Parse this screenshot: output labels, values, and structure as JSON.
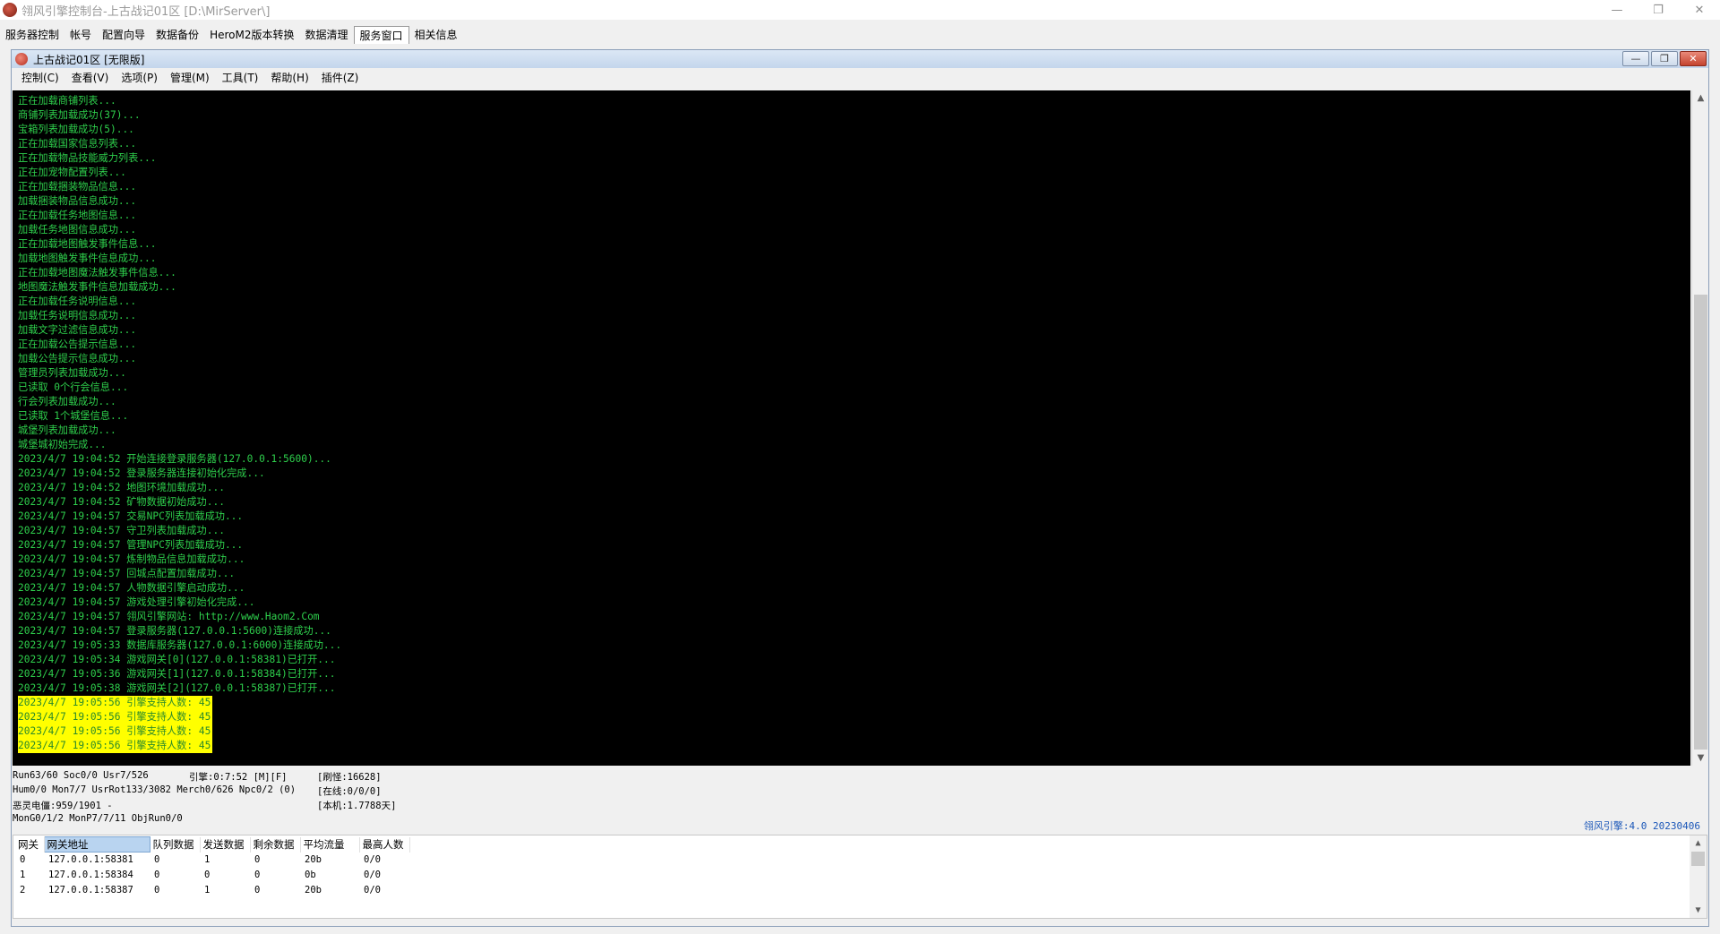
{
  "window": {
    "title": "翎风引擎控制台-上古战记01区 [D:\\MirServer\\]",
    "minimize": "—",
    "maximize": "❐",
    "close": "✕"
  },
  "outer_menu": [
    "服务器控制",
    "帐号",
    "配置向导",
    "数据备份",
    "HeroM2版本转换",
    "数据清理",
    "服务窗口",
    "相关信息"
  ],
  "mdi": {
    "title": "上古战记01区 [无限版]",
    "menu": [
      "控制(C)",
      "查看(V)",
      "选项(P)",
      "管理(M)",
      "工具(T)",
      "帮助(H)",
      "插件(Z)"
    ]
  },
  "log": [
    "正在加载商铺列表...",
    "商铺列表加载成功(37)...",
    "宝箱列表加载成功(5)...",
    "正在加载国家信息列表...",
    "正在加载物品技能威力列表...",
    "正在加宠物配置列表...",
    "正在加载捆装物品信息...",
    "加载捆装物品信息成功...",
    "正在加载任务地图信息...",
    "加载任务地图信息成功...",
    "正在加载地图触发事件信息...",
    "加载地图触发事件信息成功...",
    "正在加载地图魔法触发事件信息...",
    "地图魔法触发事件信息加载成功...",
    "正在加载任务说明信息...",
    "加载任务说明信息成功...",
    "加载文字过滤信息成功...",
    "正在加载公告提示信息...",
    "加载公告提示信息成功...",
    "管理员列表加载成功...",
    "已读取 0个行会信息...",
    "行会列表加载成功...",
    "已读取 1个城堡信息...",
    "城堡列表加载成功...",
    "城堡城初始完成...",
    "2023/4/7 19:04:52 开始连接登录服务器(127.0.0.1:5600)...",
    "2023/4/7 19:04:52 登录服务器连接初始化完成...",
    "2023/4/7 19:04:52 地图环境加载成功...",
    "2023/4/7 19:04:52 矿物数据初始成功...",
    "2023/4/7 19:04:57 交易NPC列表加载成功...",
    "2023/4/7 19:04:57 守卫列表加载成功...",
    "2023/4/7 19:04:57 管理NPC列表加载成功...",
    "2023/4/7 19:04:57 炼制物品信息加载成功...",
    "2023/4/7 19:04:57 回城点配置加载成功...",
    "2023/4/7 19:04:57 人物数据引擎启动成功...",
    "2023/4/7 19:04:57 游戏处理引擎初始化完成...",
    "2023/4/7 19:04:57 翎风引擎网站: http://www.Haom2.Com",
    "2023/4/7 19:04:57 登录服务器(127.0.0.1:5600)连接成功...",
    "2023/4/7 19:05:33 数据库服务器(127.0.0.1:6000)连接成功...",
    "2023/4/7 19:05:34 游戏网关[0](127.0.0.1:58381)已打开...",
    "2023/4/7 19:05:36 游戏网关[1](127.0.0.1:58384)已打开...",
    "2023/4/7 19:05:38 游戏网关[2](127.0.0.1:58387)已打开..."
  ],
  "log_highlight": [
    "2023/4/7 19:05:56 引擎支持人数: 45",
    "2023/4/7 19:05:56 引擎支持人数: 45",
    "2023/4/7 19:05:56 引擎支持人数: 45",
    "2023/4/7 19:05:56 引擎支持人数: 45"
  ],
  "status": {
    "run": "Run63/60 Soc0/0 Usr7/526",
    "engine": "引擎:0:7:52 [M][F]",
    "refresh": "[刷怪:16628]",
    "hum": "Hum0/0 Mon7/7 UsrRot133/3082 Merch0/626 Npc0/2 (0)",
    "online": "[在线:0/0/0]",
    "ghost": "恶灵电僵:959/1901 -",
    "local": "[本机:1.7788天]",
    "mongo": "MonG0/1/2 MonP7/7/11 ObjRun0/0",
    "version": "翎风引擎:4.0 20230406"
  },
  "gateway": {
    "headers": [
      "网关",
      "网关地址",
      "队列数据",
      "发送数据",
      "剩余数据",
      "平均流量",
      "最高人数"
    ],
    "rows": [
      [
        "0",
        "127.0.0.1:58381",
        "0",
        "1",
        "0",
        "20b",
        "0/0"
      ],
      [
        "1",
        "127.0.0.1:58384",
        "0",
        "0",
        "0",
        "0b",
        "0/0"
      ],
      [
        "2",
        "127.0.0.1:58387",
        "0",
        "1",
        "0",
        "20b",
        "0/0"
      ]
    ]
  },
  "colors": {
    "log_text": "#2ecf4c",
    "highlight_bg": "#ffff00",
    "console_bg": "#000000",
    "version_text": "#1a56b8"
  },
  "icons": {
    "scroll_up": "▲",
    "scroll_down": "▼"
  }
}
